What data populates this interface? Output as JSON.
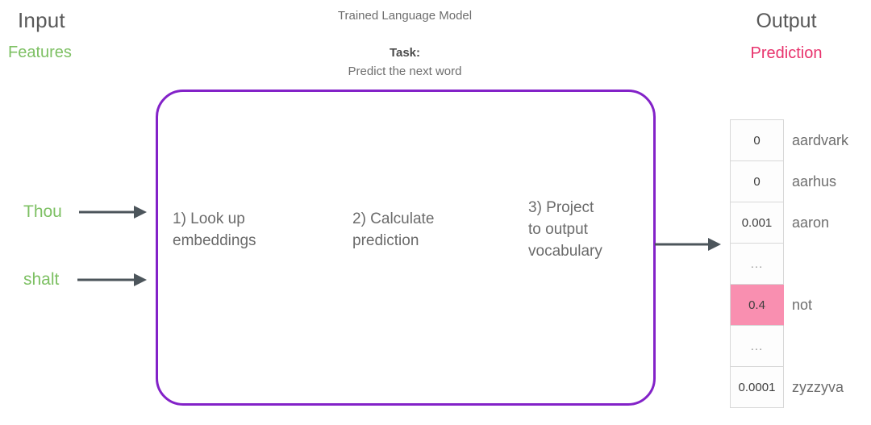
{
  "colors": {
    "green": "#7DC063",
    "pink_text": "#E8336D",
    "pink_highlight": "#F98FB0",
    "purple_box": "#8322C8",
    "arrow_gray": "#4C555B",
    "body_gray": "#6e6e6e",
    "heading_gray": "#595959",
    "cell_border": "#d8d8d8",
    "background": "#ffffff"
  },
  "left_panel": {
    "title": "Input",
    "subtitle": "Features",
    "words": [
      {
        "text": "Thou"
      },
      {
        "text": "shalt"
      }
    ]
  },
  "center_panel": {
    "model_title": "Trained Language Model",
    "task_label": "Task:",
    "task_value": "Predict the next word",
    "steps": [
      {
        "text": "1) Look up\nembeddings"
      },
      {
        "text": "2) Calculate\nprediction"
      },
      {
        "text": "3) Project\nto output\nvocabulary"
      }
    ]
  },
  "right_panel": {
    "title": "Output",
    "subtitle": "Prediction",
    "table": {
      "rows": [
        {
          "value": "0",
          "label": "aardvark",
          "highlight": false,
          "ellipsis": false
        },
        {
          "value": "0",
          "label": "aarhus",
          "highlight": false,
          "ellipsis": false
        },
        {
          "value": "0.001",
          "label": "aaron",
          "highlight": false,
          "ellipsis": false
        },
        {
          "value": "...",
          "label": "",
          "highlight": false,
          "ellipsis": true
        },
        {
          "value": "0.4",
          "label": "not",
          "highlight": true,
          "ellipsis": false
        },
        {
          "value": "...",
          "label": "",
          "highlight": false,
          "ellipsis": true
        },
        {
          "value": "0.0001",
          "label": "zyzzyva",
          "highlight": false,
          "ellipsis": false
        }
      ]
    }
  },
  "arrows": [
    {
      "name": "arrow-input-thou",
      "from": "Thou",
      "to": "model"
    },
    {
      "name": "arrow-input-shalt",
      "from": "shalt",
      "to": "model"
    },
    {
      "name": "arrow-model-output",
      "from": "model",
      "to": "output-table"
    }
  ]
}
